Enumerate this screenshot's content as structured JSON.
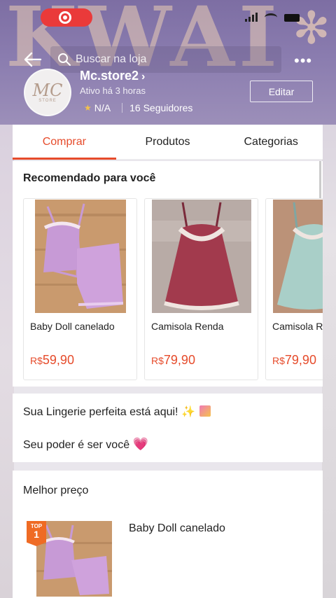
{
  "status_bar": {
    "recording_icon": "record-icon"
  },
  "watermark": {
    "text": "KWAI",
    "flower": "✻"
  },
  "header": {
    "search_placeholder": "Buscar na loja",
    "more_icon": "•••",
    "store_name": "Mc.store2",
    "store_chevron": "›",
    "active_text": "Ativo há 3 horas",
    "rating": "N/A",
    "followers": "16 Seguidores",
    "edit_label": "Editar",
    "avatar_text": "MC",
    "avatar_sub": "STORE"
  },
  "tabs": [
    {
      "label": "Comprar",
      "active": true
    },
    {
      "label": "Produtos",
      "active": false
    },
    {
      "label": "Categorias",
      "active": false
    }
  ],
  "recommended": {
    "title": "Recomendado para você",
    "products": [
      {
        "name": "Baby Doll canelado",
        "currency": "R$",
        "price": "59,90"
      },
      {
        "name": "Camisola Renda",
        "currency": "R$",
        "price": "79,90"
      },
      {
        "name": "Camisola Renda",
        "currency": "R$",
        "price": "79,90"
      }
    ]
  },
  "info": {
    "line1": "Sua Lingerie perfeita está aqui!",
    "line1_icon": "✨",
    "line2": "Seu poder é ser você",
    "line2_icon": "💗"
  },
  "best_price": {
    "title": "Melhor preço",
    "badge_label": "TOP",
    "badge_num": "1",
    "product_name": "Baby Doll canelado"
  },
  "colors": {
    "accent": "#e64b2b",
    "header": "#8a7caf",
    "badge": "#ef6b24"
  }
}
